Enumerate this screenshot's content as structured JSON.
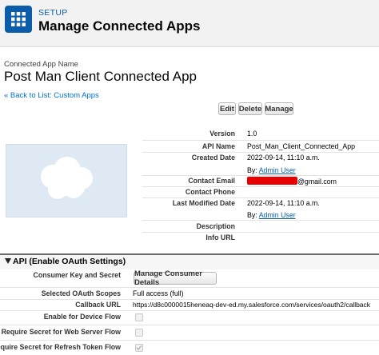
{
  "header": {
    "section": "SETUP",
    "title": "Manage Connected Apps",
    "icon": "grid-icon",
    "icon_color": "#0b5cab"
  },
  "app": {
    "name_label": "Connected App Name",
    "name": "Post Man Client Connected App",
    "back_link": "« Back to List: Custom Apps"
  },
  "buttons": {
    "edit": "Edit",
    "delete": "Delete",
    "manage": "Manage"
  },
  "details": {
    "version_label": "Version",
    "version": "1.0",
    "api_name_label": "API Name",
    "api_name": "Post_Man_Client_Connected_App",
    "created_date_label": "Created Date",
    "created_date": "2022-09-14, 11:10 a.m.",
    "created_by_prefix": "By:",
    "created_by": "Admin User",
    "contact_email_label": "Contact Email",
    "contact_email_suffix": "@gmail.com",
    "contact_phone_label": "Contact Phone",
    "last_modified_label": "Last Modified Date",
    "last_modified": "2022-09-14, 11:10 a.m.",
    "modified_by_prefix": "By:",
    "modified_by": "Admin User",
    "description_label": "Description",
    "info_url_label": "Info URL"
  },
  "oauth": {
    "section_title": "API (Enable OAuth Settings)",
    "consumer_label": "Consumer Key and Secret",
    "consumer_button": "Manage Consumer Details",
    "scopes_label": "Selected OAuth Scopes",
    "scopes": "Full access (full)",
    "callback_label": "Callback URL",
    "callback": "https://d8c0000015heneaq-dev-ed.my.salesforce.com/services/oauth2/callback",
    "device_flow_label": "Enable for Device Flow",
    "web_server_label": "Require Secret for Web Server Flow",
    "refresh_label": "Require Secret for Refresh Token Flow"
  }
}
